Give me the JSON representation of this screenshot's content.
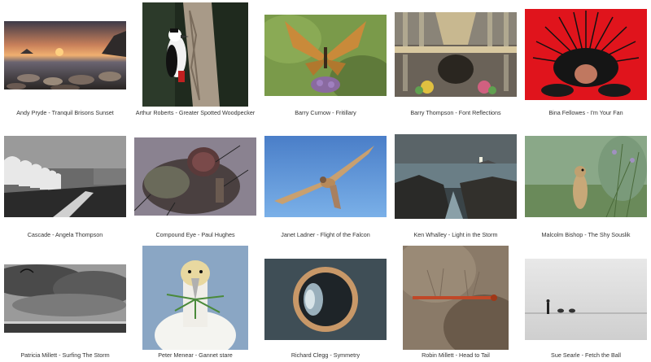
{
  "gallery": {
    "items": [
      {
        "caption": "Andy Pryde - Tranquil Brisons Sunset"
      },
      {
        "caption": "Arthur Roberts - Greater Spotted Woodpecker"
      },
      {
        "caption": "Barry Curnow - Fritillary"
      },
      {
        "caption": "Barry Thompson - Font Reflections"
      },
      {
        "caption": "Bina Fellowes - I'm Your Fan"
      },
      {
        "caption": "Cascade - Angela Thompson"
      },
      {
        "caption": "Compound Eye - Paul Hughes"
      },
      {
        "caption": "Janet Ladner - Flight of the Falcon"
      },
      {
        "caption": "Ken Whalley - Light in the Storm"
      },
      {
        "caption": "Malcolm Bishop - The Shy Souslik"
      },
      {
        "caption": "Patricia Millett - Surfing The Storm"
      },
      {
        "caption": "Peter Menear - Gannet stare"
      },
      {
        "caption": "Richard Clegg - Symmetry"
      },
      {
        "caption": "Robin Millett - Head to Tail"
      },
      {
        "caption": "Sue Searle - Fetch the Ball"
      }
    ]
  }
}
